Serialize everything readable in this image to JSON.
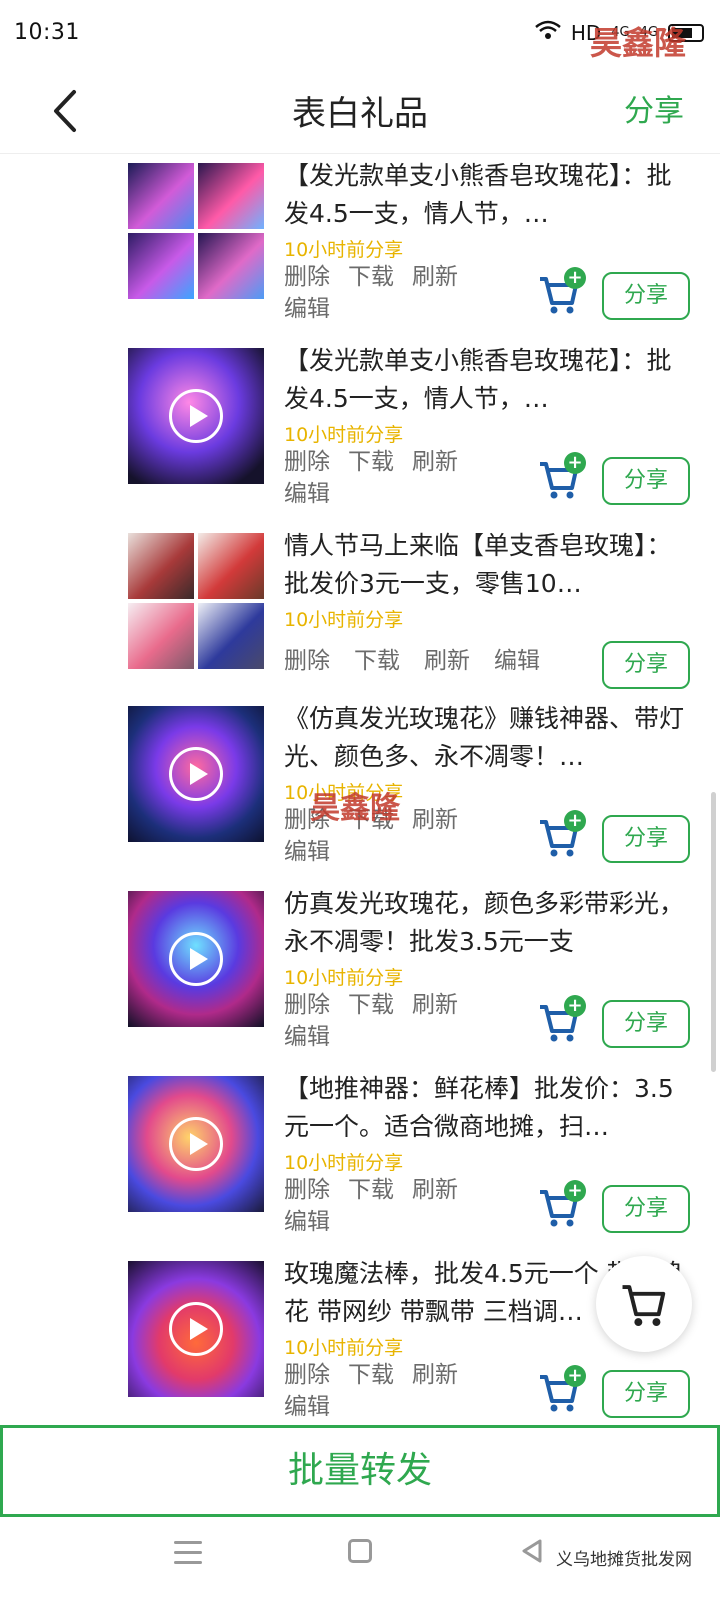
{
  "status_bar": {
    "time": "10:31",
    "icons": [
      "wifi-icon",
      "hd-icon",
      "signal-4g-icon",
      "signal-4g-icon",
      "battery-icon"
    ],
    "hd_label": "HD",
    "net1": "4G",
    "net2": "4G",
    "watermark": "昊鑫隆"
  },
  "header": {
    "title": "表白礼品",
    "share_label": "分享",
    "accent_color": "#2fa84f"
  },
  "items": [
    {
      "title": "【发光款单支小熊香皂玫瑰花】：批发4.5一支，情人节，…",
      "time": "10小时前分享",
      "actions": [
        "删除",
        "下载",
        "刷新",
        "编辑"
      ],
      "thumb_type": "grid",
      "has_video": false,
      "has_cart": true,
      "share_label": "分享"
    },
    {
      "title": "【发光款单支小熊香皂玫瑰花】：批发4.5一支，情人节，…",
      "time": "10小时前分享",
      "actions": [
        "删除",
        "下载",
        "刷新",
        "编辑"
      ],
      "thumb_type": "video",
      "has_video": true,
      "has_cart": true,
      "share_label": "分享"
    },
    {
      "title": "情人节马上来临【单支香皂玫瑰】：批发价3元一支，零售10…",
      "time": "10小时前分享",
      "actions": [
        "删除",
        "下载",
        "刷新",
        "编辑"
      ],
      "thumb_type": "grid",
      "has_video": false,
      "has_cart": false,
      "share_label": "分享"
    },
    {
      "title": "《仿真发光玫瑰花》赚钱神器、带灯光、颜色多、永不凋零！…",
      "time": "10小时前分享",
      "actions": [
        "删除",
        "下载",
        "刷新",
        "编辑"
      ],
      "thumb_type": "video",
      "has_video": true,
      "has_cart": true,
      "share_label": "分享"
    },
    {
      "title": "仿真发光玫瑰花，颜色多彩带彩光，永不凋零！批发3.5元一支",
      "time": "10小时前分享",
      "actions": [
        "删除",
        "下载",
        "刷新",
        "编辑"
      ],
      "thumb_type": "video",
      "has_video": true,
      "has_cart": true,
      "share_label": "分享"
    },
    {
      "title": "【地推神器：鲜花棒】批发价：3.5元一个。适合微商地摊，扫…",
      "time": "10小时前分享",
      "actions": [
        "删除",
        "下载",
        "刷新",
        "编辑"
      ],
      "thumb_type": "video",
      "has_video": true,
      "has_cart": true,
      "share_label": "分享"
    },
    {
      "title": "玫瑰魔法棒，批发4.5元一个 带玫瑰花 带网纱 带飘带 三档调…",
      "time": "10小时前分享",
      "actions": [
        "删除",
        "下载",
        "刷新",
        "编辑"
      ],
      "thumb_type": "video",
      "has_video": true,
      "has_cart": true,
      "share_label": "分享"
    }
  ],
  "mid_watermark": "昊鑫隆",
  "bulk_forward_label": "批量转发",
  "system_nav": {
    "icons": [
      "menu-icon",
      "home-icon",
      "back-icon"
    ],
    "source_watermark": "义乌地摊货批发网"
  }
}
